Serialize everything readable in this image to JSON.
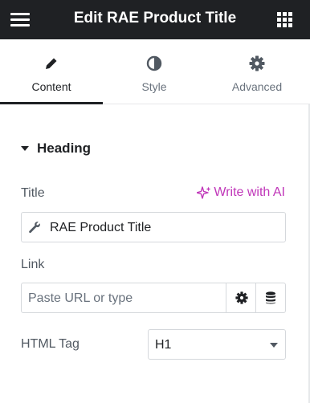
{
  "header": {
    "title": "Edit RAE Product Title",
    "menu_icon": "hamburger-menu-icon",
    "apps_icon": "grid-apps-icon"
  },
  "tabs": [
    {
      "label": "Content",
      "icon": "pencil-icon",
      "active": true
    },
    {
      "label": "Style",
      "icon": "half-circle-contrast-icon",
      "active": false
    },
    {
      "label": "Advanced",
      "icon": "gear-icon",
      "active": false
    }
  ],
  "section": {
    "title": "Heading",
    "expanded": true
  },
  "title_control": {
    "label": "Title",
    "ai_link": "Write with AI",
    "value": "RAE Product Title",
    "dynamic_icon": "wrench-icon"
  },
  "link_control": {
    "label": "Link",
    "placeholder": "Paste URL or type"
  },
  "html_tag_control": {
    "label": "HTML Tag",
    "selected": "H1"
  },
  "colors": {
    "header_bg": "#1f2124",
    "ai_accent": "#c036b9",
    "border": "#d5d8dc",
    "muted_text": "#69727d"
  }
}
